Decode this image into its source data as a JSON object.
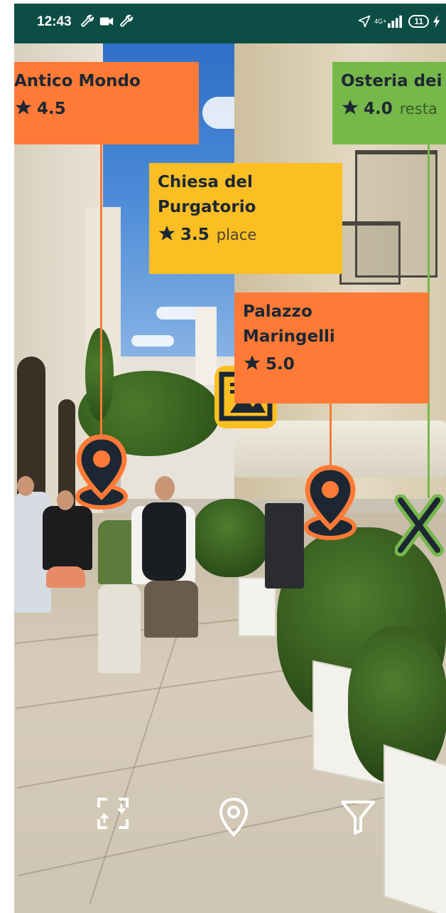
{
  "status_bar": {
    "time": "12:43",
    "left_icons": [
      "wrench-icon",
      "video-camera-icon",
      "wrench-icon"
    ],
    "network_label": "4G+",
    "battery": "11",
    "right_icons": [
      "location-arrow-icon",
      "signal-icon",
      "battery-icon",
      "charging-icon"
    ]
  },
  "poi_cards": [
    {
      "name": "Antico Mondo",
      "rating": "4.5",
      "category": "",
      "color": "#ff7a36",
      "marker_icon": "map-pin-icon"
    },
    {
      "name": "Osteria dei",
      "rating": "4.0",
      "category": "resta",
      "color": "#76b84a",
      "marker_icon": "fork-knife-icon"
    },
    {
      "name_line1": "Chiesa del",
      "name_line2": "Purgatorio",
      "rating": "3.5",
      "category": "place",
      "color": "#fbbf24",
      "marker_icon": "museum-icon"
    },
    {
      "name_line1": "Palazzo",
      "name_line2": "Maringelli",
      "rating": "5.0",
      "category": "",
      "color": "#ff7a36",
      "marker_icon": "map-pin-icon"
    }
  ],
  "colors": {
    "status_bar_bg": "#0c4d45",
    "orange": "#ff7a36",
    "green": "#76b84a",
    "yellow": "#fbbf24",
    "dark_navy": "#1d2733"
  },
  "toolbar": {
    "items": [
      {
        "icon": "fit-screen-icon"
      },
      {
        "icon": "location-pin-outline-icon"
      },
      {
        "icon": "filter-icon"
      }
    ]
  }
}
